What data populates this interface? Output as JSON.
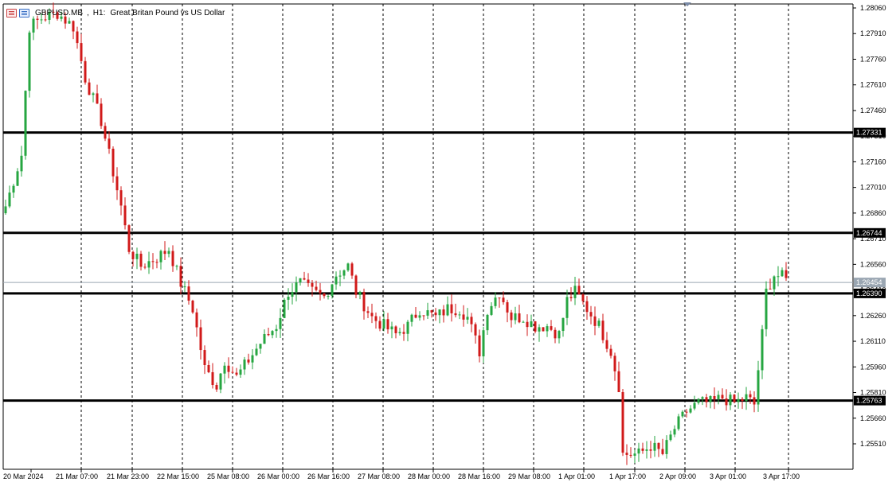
{
  "header": {
    "symbol": "GBPUSD.MB",
    "timeframe": "H1:",
    "description": "Great Britan Pound vs US Dollar",
    "icons": [
      "chart-window-icon",
      "symbol-properties-icon"
    ]
  },
  "colors": {
    "bull": "#26a641",
    "bear": "#d11a1a",
    "grid": "#000000",
    "level": "#000000",
    "price_line": "#9aa6b2"
  },
  "price_axis": {
    "ticks": [
      "1.28060",
      "1.27910",
      "1.27760",
      "1.27610",
      "1.27460",
      "1.27310",
      "1.27160",
      "1.27010",
      "1.26860",
      "1.26710",
      "1.26560",
      "1.26410",
      "1.26260",
      "1.26110",
      "1.25960",
      "1.25810",
      "1.25660",
      "1.25510"
    ],
    "current_price": "1.26454"
  },
  "time_axis": {
    "labels": [
      "20 Mar 2024",
      "21 Mar 07:00",
      "21 Mar 23:00",
      "22 Mar 15:00",
      "25 Mar 08:00",
      "26 Mar 00:00",
      "26 Mar 16:00",
      "27 Mar 08:00",
      "28 Mar 00:00",
      "28 Mar 16:00",
      "29 Mar 08:00",
      "1 Apr 01:00",
      "1 Apr 17:00",
      "2 Apr 09:00",
      "3 Apr 01:00",
      "3 Apr 17:00"
    ]
  },
  "chart_data": {
    "type": "candlestick",
    "symbol": "GBPUSD.MB",
    "timeframe": "H1",
    "ylim": [
      1.2541,
      1.2808
    ],
    "grid": "vertical dashed",
    "horizontal_levels": [
      {
        "label": "1.27331",
        "value": 1.27331
      },
      {
        "label": "1.26744",
        "value": 1.26744
      },
      {
        "label": "1.26390",
        "value": 1.2639
      },
      {
        "label": "1.25763",
        "value": 1.25763
      }
    ],
    "anchors": [
      [
        0,
        1.269
      ],
      [
        4,
        1.272
      ],
      [
        6,
        1.2795
      ],
      [
        9,
        1.28
      ],
      [
        13,
        1.2803
      ],
      [
        17,
        1.2795
      ],
      [
        20,
        1.2765
      ],
      [
        24,
        1.274
      ],
      [
        26,
        1.272
      ],
      [
        29,
        1.269
      ],
      [
        31,
        1.2665
      ],
      [
        34,
        1.2655
      ],
      [
        38,
        1.266
      ],
      [
        41,
        1.2665
      ],
      [
        44,
        1.2645
      ],
      [
        47,
        1.263
      ],
      [
        50,
        1.2595
      ],
      [
        53,
        1.2585
      ],
      [
        55,
        1.26
      ],
      [
        58,
        1.259
      ],
      [
        61,
        1.26
      ],
      [
        64,
        1.261
      ],
      [
        68,
        1.262
      ],
      [
        71,
        1.264
      ],
      [
        74,
        1.2645
      ],
      [
        77,
        1.264
      ],
      [
        80,
        1.2637
      ],
      [
        83,
        1.265
      ],
      [
        86,
        1.2655
      ],
      [
        88,
        1.264
      ],
      [
        92,
        1.2625
      ],
      [
        95,
        1.262
      ],
      [
        98,
        1.2615
      ],
      [
        101,
        1.262
      ],
      [
        104,
        1.263
      ],
      [
        108,
        1.2625
      ],
      [
        111,
        1.263
      ],
      [
        114,
        1.263
      ],
      [
        116,
        1.2625
      ],
      [
        119,
        1.2605
      ],
      [
        121,
        1.263
      ],
      [
        124,
        1.264
      ],
      [
        127,
        1.2625
      ],
      [
        130,
        1.2625
      ],
      [
        133,
        1.262
      ],
      [
        136,
        1.262
      ],
      [
        139,
        1.2615
      ],
      [
        141,
        1.2635
      ],
      [
        143,
        1.264
      ],
      [
        146,
        1.263
      ],
      [
        149,
        1.262
      ],
      [
        152,
        1.2605
      ],
      [
        154,
        1.2585
      ],
      [
        155,
        1.2545
      ],
      [
        159,
        1.2545
      ],
      [
        162,
        1.255
      ],
      [
        165,
        1.2545
      ],
      [
        168,
        1.256
      ],
      [
        171,
        1.257
      ],
      [
        174,
        1.2575
      ],
      [
        177,
        1.2575
      ],
      [
        180,
        1.2578
      ],
      [
        183,
        1.2575
      ],
      [
        186,
        1.2578
      ],
      [
        188,
        1.2574
      ],
      [
        190,
        1.2615
      ],
      [
        191,
        1.264
      ],
      [
        193,
        1.265
      ],
      [
        196,
        1.2648
      ]
    ]
  }
}
